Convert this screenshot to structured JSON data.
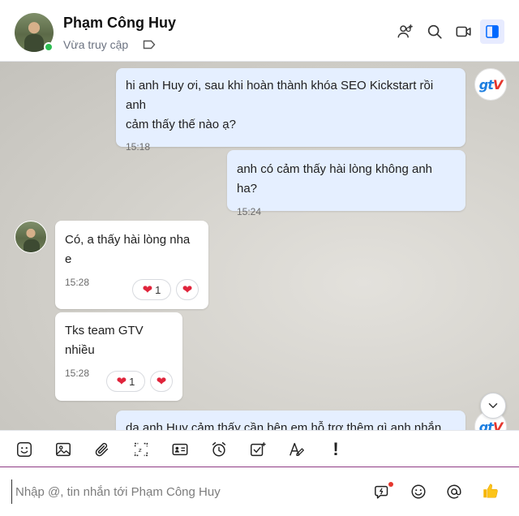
{
  "header": {
    "contact_name": "Phạm Công Huy",
    "status": "Vừa truy cập",
    "icons": [
      "add-member-icon",
      "search-icon",
      "video-call-icon",
      "toggle-panel-icon"
    ]
  },
  "messages": [
    {
      "direction": "out",
      "text": "hi anh Huy ơi, sau khi hoàn thành khóa SEO Kickstart rồi anh\ncảm thấy thế nào ạ?",
      "time": "15:18"
    },
    {
      "direction": "out",
      "text": "anh có cảm thấy hài lòng không anh ha?",
      "time": "15:24"
    },
    {
      "direction": "in",
      "text": "Có, a thấy hài lòng nha e",
      "time": "15:28",
      "reaction_count": "1"
    },
    {
      "direction": "in",
      "text": "Tks team GTV nhiều",
      "time": "15:28",
      "reaction_count": "1"
    },
    {
      "direction": "out",
      "text": "da anh Huy cảm thấy cần bên em hỗ trợ thêm gì anh nhắn"
    }
  ],
  "brand": {
    "logo_main": "gt",
    "logo_accent": "V"
  },
  "toolbar": {
    "icons": [
      "sticker-icon",
      "image-icon",
      "attachment-icon",
      "screenshot-icon",
      "contact-card-icon",
      "reminder-clock-icon",
      "task-icon",
      "text-format-icon",
      "important-icon"
    ],
    "important_glyph": "!"
  },
  "composer": {
    "placeholder": "Nhập @, tin nhắn tới Phạm Công Huy",
    "value": "",
    "icons": [
      "quick-message-icon",
      "emoji-icon",
      "mention-icon",
      "like-icon"
    ]
  },
  "colors": {
    "accent": "#0068ff",
    "outgoing_bubble": "#e5efff",
    "online": "#2dbd52",
    "heart": "#e0243b",
    "divider": "#8e3b84"
  }
}
